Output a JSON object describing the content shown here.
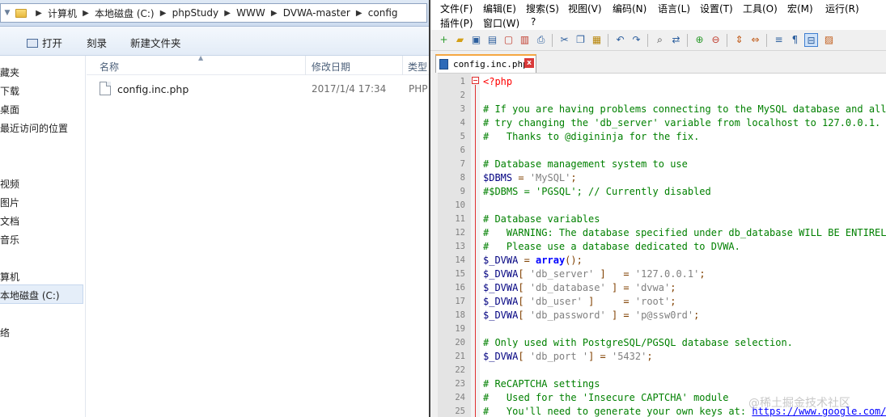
{
  "explorer": {
    "breadcrumb": [
      "计算机",
      "本地磁盘 (C:)",
      "phpStudy",
      "WWW",
      "DVWA-master",
      "config"
    ],
    "commands": {
      "open": "打开",
      "burn": "刻录",
      "new_folder": "新建文件夹"
    },
    "nav": [
      "藏夹",
      "下载",
      "桌面",
      "最近访问的位置",
      "视频",
      "图片",
      "文档",
      "音乐",
      "算机",
      "本地磁盘 (C:)",
      "络"
    ],
    "columns": {
      "name": "名称",
      "date": "修改日期",
      "type": "类型"
    },
    "file": {
      "name": "config.inc.php",
      "date": "2017/1/4 17:34",
      "type": "PHP"
    }
  },
  "npp": {
    "menu_row1": [
      "文件(F)",
      "编辑(E)",
      "搜索(S)",
      "视图(V)",
      "编码(N)",
      "语言(L)",
      "设置(T)",
      "工具(O)",
      "宏(M)",
      "运行(R)"
    ],
    "menu_row2": [
      "插件(P)",
      "窗口(W)",
      "?"
    ],
    "tab_label": "config.inc.php",
    "tab_close": "x",
    "code_lines": [
      {
        "n": "1",
        "t": "<?php",
        "k": "tag"
      },
      {
        "n": "2",
        "t": "",
        "k": "plain"
      },
      {
        "n": "3",
        "t": "# If you are having problems connecting to the MySQL database and all of the v",
        "k": "comment"
      },
      {
        "n": "4",
        "t": "# try changing the 'db_server' variable from localhost to 127.0.0.1. Fixes a p",
        "k": "comment"
      },
      {
        "n": "5",
        "t": "#   Thanks to @digininja for the fix.",
        "k": "comment"
      },
      {
        "n": "6",
        "t": "",
        "k": "plain"
      },
      {
        "n": "7",
        "t": "# Database management system to use",
        "k": "comment"
      },
      {
        "n": "8",
        "t": "$DBMS = 'MySQL';",
        "k": "assign"
      },
      {
        "n": "9",
        "t": "#$DBMS = 'PGSQL'; // Currently disabled",
        "k": "comment"
      },
      {
        "n": "10",
        "t": "",
        "k": "plain"
      },
      {
        "n": "11",
        "t": "# Database variables",
        "k": "comment"
      },
      {
        "n": "12",
        "t": "#   WARNING: The database specified under db_database WILL BE ENTIRELY DELETED",
        "k": "comment"
      },
      {
        "n": "13",
        "t": "#   Please use a database dedicated to DVWA.",
        "k": "comment"
      },
      {
        "n": "14",
        "t": "$_DVWA = array();",
        "k": "array"
      },
      {
        "n": "15",
        "t": "$_DVWA[ 'db_server' ]   = '127.0.0.1';",
        "k": "assign"
      },
      {
        "n": "16",
        "t": "$_DVWA[ 'db_database' ] = 'dvwa';",
        "k": "assign"
      },
      {
        "n": "17",
        "t": "$_DVWA[ 'db_user' ]     = 'root';",
        "k": "assign"
      },
      {
        "n": "18",
        "t": "$_DVWA[ 'db_password' ] = 'p@ssw0rd';",
        "k": "assign"
      },
      {
        "n": "19",
        "t": "",
        "k": "plain"
      },
      {
        "n": "20",
        "t": "# Only used with PostgreSQL/PGSQL database selection.",
        "k": "comment"
      },
      {
        "n": "21",
        "t": "$_DVWA[ 'db_port '] = '5432';",
        "k": "assign"
      },
      {
        "n": "22",
        "t": "",
        "k": "plain"
      },
      {
        "n": "23",
        "t": "# ReCAPTCHA settings",
        "k": "comment"
      },
      {
        "n": "24",
        "t": "#   Used for the 'Insecure CAPTCHA' module",
        "k": "comment"
      },
      {
        "n": "25",
        "t": "#   You'll need to generate your own keys at: https://www.google.com/recaptcha",
        "k": "comment"
      }
    ]
  },
  "watermark": "@稀土掘金技术社区"
}
